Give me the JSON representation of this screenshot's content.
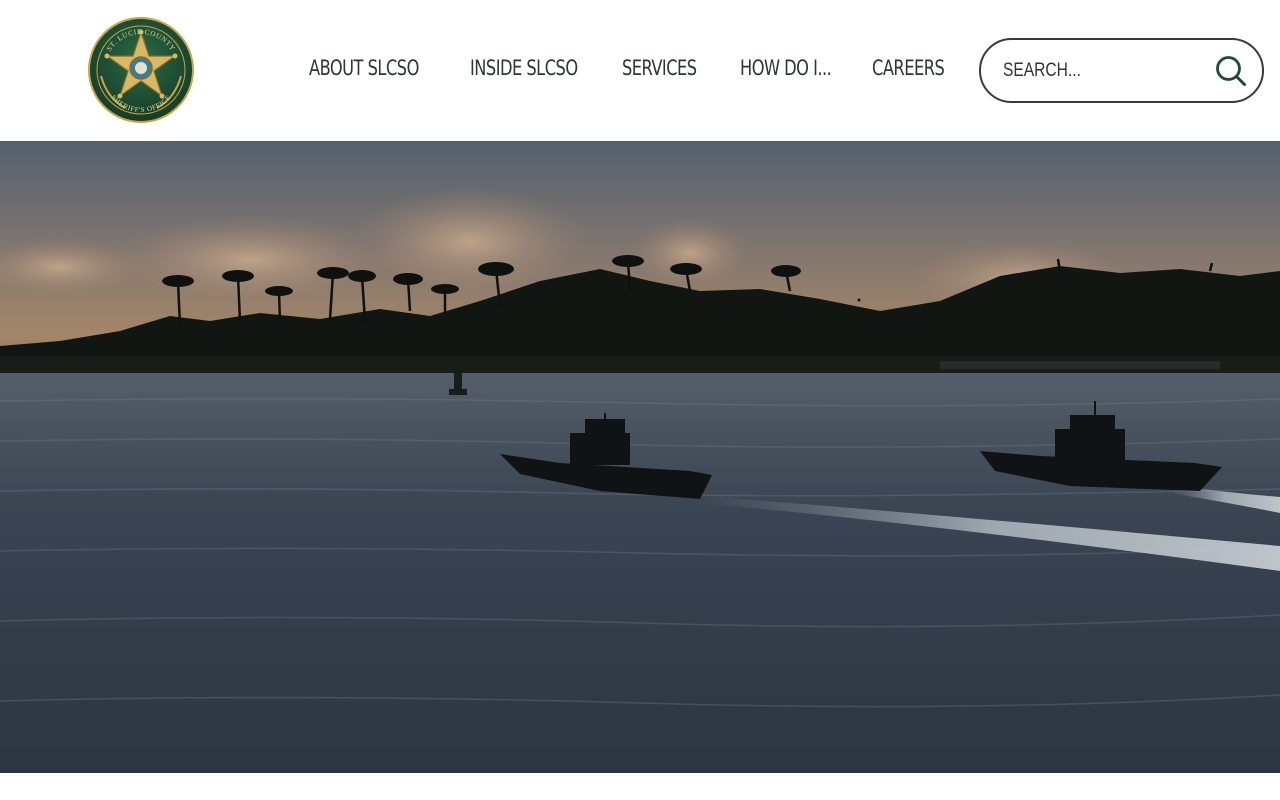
{
  "header": {
    "logo": {
      "top_text": "ST. LUCIE COUNTY",
      "bottom_text": "SHERIFF'S OFFICE",
      "colors": {
        "ring": "#1e4b30",
        "gold": "#c9a44a",
        "inner": "#0f3d2b"
      }
    },
    "nav": [
      {
        "label": "ABOUT SLCSO"
      },
      {
        "label": "INSIDE SLCSO"
      },
      {
        "label": "SERVICES"
      },
      {
        "label": "HOW DO I..."
      },
      {
        "label": "CAREERS"
      }
    ],
    "search": {
      "placeholder": "SEARCH...",
      "value": "",
      "icon": "search-icon"
    }
  },
  "hero": {
    "scene": "two-patrol-boats-at-sunset",
    "colors": {
      "sky_top": "#5f6d7a",
      "sky_horizon": "#b39272",
      "water": "#3c4654",
      "treeline": "#121512"
    }
  }
}
